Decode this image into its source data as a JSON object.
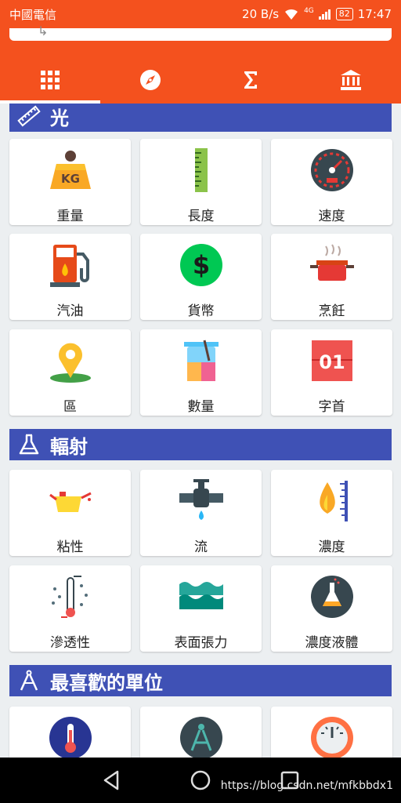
{
  "status_bar": {
    "carrier": "中國電信",
    "speed": "20 B/s",
    "network": "4G",
    "battery": "82",
    "time": "17:47"
  },
  "tabs": [
    {
      "icon": "grid-icon",
      "active": true
    },
    {
      "icon": "compass-icon",
      "active": false
    },
    {
      "icon": "sigma-icon",
      "active": false
    },
    {
      "icon": "bank-icon",
      "active": false
    }
  ],
  "sections": {
    "light": {
      "title": "光",
      "icon": "ruler-icon"
    },
    "radiation": {
      "title": "輻射",
      "icon": "flask-icon"
    },
    "favorites": {
      "title": "最喜歡的單位",
      "icon": "compass-drawing-icon"
    }
  },
  "cards": {
    "weight": "重量",
    "length": "長度",
    "speed": "速度",
    "fuel": "汽油",
    "currency": "貨幣",
    "cooking": "烹飪",
    "area": "區",
    "quantity": "數量",
    "typography": "字首",
    "viscosity": "粘性",
    "flow": "流",
    "concentration": "濃度",
    "permeability": "滲透性",
    "surface_tension": "表面張力",
    "liquid_concentration": "濃度液體"
  },
  "icon_text": {
    "weight_badge": "KG",
    "typography_badge": "01",
    "currency_symbol": "$"
  },
  "watermark": "https://blog.csdn.net/mfkbbdx1",
  "colors": {
    "primary": "#f4511e",
    "section": "#3f51b5",
    "background": "#eceff1"
  }
}
